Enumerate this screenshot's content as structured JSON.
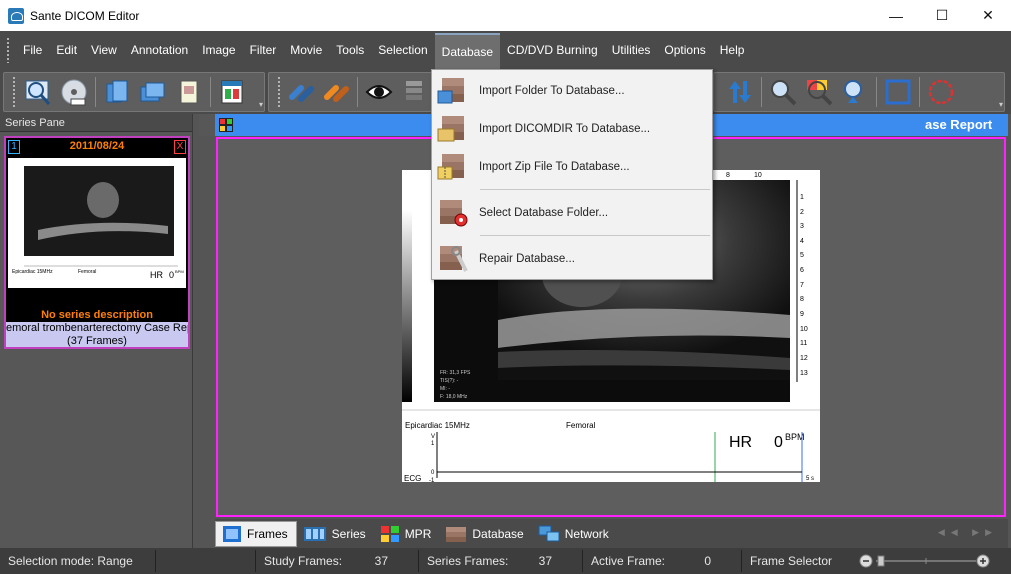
{
  "window": {
    "title": "Sante DICOM Editor",
    "minimize": "—",
    "maximize": "☐",
    "close": "✕"
  },
  "menu": [
    {
      "label": "File"
    },
    {
      "label": "Edit"
    },
    {
      "label": "View"
    },
    {
      "label": "Annotation"
    },
    {
      "label": "Image"
    },
    {
      "label": "Filter"
    },
    {
      "label": "Movie"
    },
    {
      "label": "Tools"
    },
    {
      "label": "Selection"
    },
    {
      "label": "Database",
      "active": true
    },
    {
      "label": "CD/DVD Burning"
    },
    {
      "label": "Utilities"
    },
    {
      "label": "Options"
    },
    {
      "label": "Help"
    }
  ],
  "database_menu": [
    {
      "label": "Import Folder To Database...",
      "icon": "folder-import-icon"
    },
    {
      "label": "Import DICOMDIR To Database...",
      "icon": "dicomdir-import-icon"
    },
    {
      "label": "Import Zip File To Database...",
      "icon": "zip-import-icon"
    },
    {
      "label": "Select Database Folder...",
      "icon": "database-folder-gear-icon"
    },
    {
      "label": "Repair Database...",
      "icon": "database-repair-icon"
    }
  ],
  "series_pane": {
    "title": "Series Pane",
    "card": {
      "index": "1",
      "date": "2011/08/24",
      "close": "X",
      "thumb_left_label": "Epicardiac 15MHz",
      "thumb_mid_label": "Femoral",
      "thumb_hr": "HR",
      "thumb_bpm": "0",
      "thumb_bpm_unit": "BPM",
      "description": "No series description",
      "name": "emoral trombenarterectomy Case Repor",
      "frames": "(37 Frames)"
    }
  },
  "viewer": {
    "title": "ase Report",
    "image": {
      "probe": "Epicardiac 15MHz",
      "site": "Femoral",
      "hr": "HR",
      "bpm": "0",
      "bpm_unit": "BPM",
      "ecg": "ECG",
      "time": "5 s",
      "v": "V",
      "ecg_ticks": [
        "1",
        "0",
        "-1"
      ],
      "top_ticks": [
        "8",
        "10"
      ],
      "depth_ticks": [
        "1",
        "2",
        "3",
        "4",
        "5",
        "6",
        "7",
        "8",
        "9",
        "10",
        "11",
        "12",
        "13"
      ],
      "info": [
        "FR: 31,3 FPS",
        "TIS(?): -",
        "MI: -",
        "F: 18,0 MHz"
      ]
    }
  },
  "tabs": [
    {
      "label": "Frames",
      "active": true,
      "icon": "frames-icon"
    },
    {
      "label": "Series",
      "icon": "series-icon"
    },
    {
      "label": "MPR",
      "icon": "mpr-icon"
    },
    {
      "label": "Database",
      "icon": "database-icon"
    },
    {
      "label": "Network",
      "icon": "network-icon"
    }
  ],
  "status": {
    "selection_mode": "Selection mode: Range",
    "study_frames_label": "Study Frames:",
    "study_frames_value": "37",
    "series_frames_label": "Series Frames:",
    "series_frames_value": "37",
    "active_frame_label": "Active Frame:",
    "active_frame_value": "0",
    "frame_selector_label": "Frame Selector"
  },
  "colors": {
    "chrome": "#4a4a4a",
    "viewer_head": "#3c8cf0",
    "viewport_border": "#ff22ff",
    "series_date": "#ff8000"
  }
}
